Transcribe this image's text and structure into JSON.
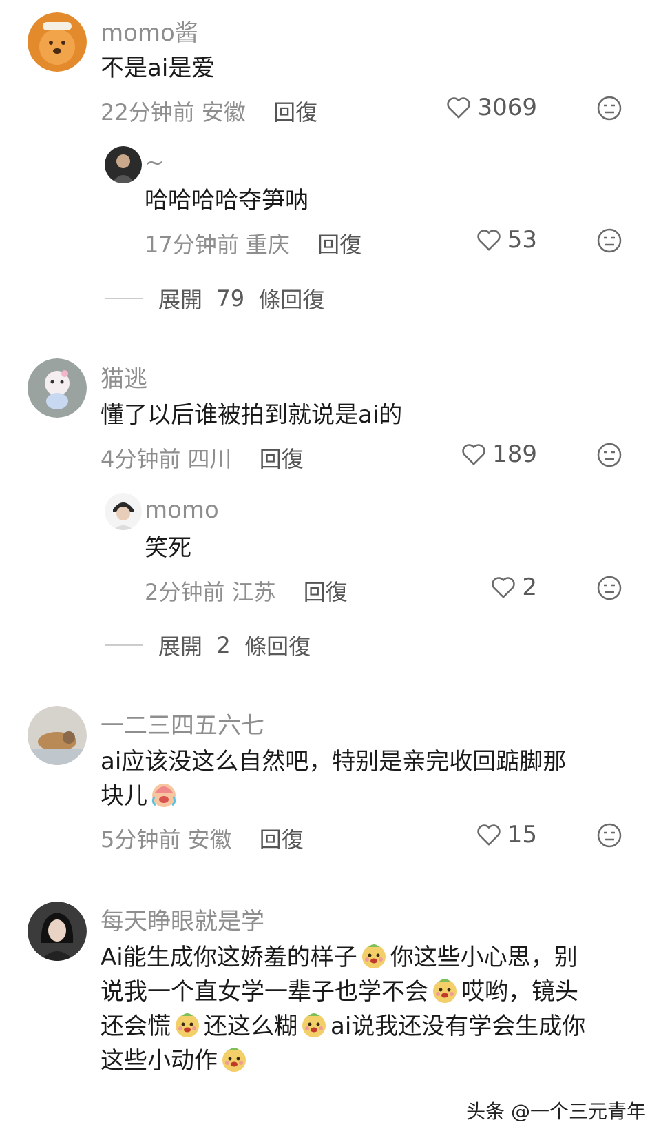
{
  "comments": [
    {
      "username": "momo酱",
      "text": "不是ai是爱",
      "time": "22分钟前",
      "location": "安徽",
      "reply_label": "回復",
      "likes": "3069",
      "replies": [
        {
          "username": "~",
          "text": "哈哈哈哈夺笋呐",
          "time": "17分钟前",
          "location": "重庆",
          "reply_label": "回復",
          "likes": "53"
        }
      ],
      "expand": {
        "prefix": "展開",
        "count": "79",
        "suffix": "條回復"
      }
    },
    {
      "username": "猫逃",
      "text": "懂了以后谁被拍到就说是ai的",
      "time": "4分钟前",
      "location": "四川",
      "reply_label": "回復",
      "likes": "189",
      "replies": [
        {
          "username": "momo",
          "text": "笑死",
          "time": "2分钟前",
          "location": "江苏",
          "reply_label": "回復",
          "likes": "2"
        }
      ],
      "expand": {
        "prefix": "展開",
        "count": "2",
        "suffix": "條回復"
      }
    },
    {
      "username": "一二三四五六七",
      "text_line1": "ai应该没这么自然吧，特别是亲完收回踮脚那",
      "text_line2": "块儿",
      "time": "5分钟前",
      "location": "安徽",
      "reply_label": "回復",
      "likes": "15"
    },
    {
      "username": "每天睁眼就是学",
      "segments": [
        "Ai能生成你这娇羞的样子",
        "你这些小心思，别",
        "说我一个直女学一辈子也学不会",
        "哎哟，镜头",
        "还会慌",
        "还这么糊",
        "ai说我还没有学会生成你",
        "这些小动作"
      ]
    }
  ],
  "watermark": "头条 @一个三元青年",
  "icons": {
    "like": "heart-outline-icon",
    "dislike": "unhappy-face-icon",
    "emoji_cry": "crying-laugh-emoji",
    "emoji_shy": "shy-dog-emoji"
  },
  "colors": {
    "meta": "#8e8e8e",
    "text": "#1a1a1a",
    "background": "#ffffff"
  }
}
